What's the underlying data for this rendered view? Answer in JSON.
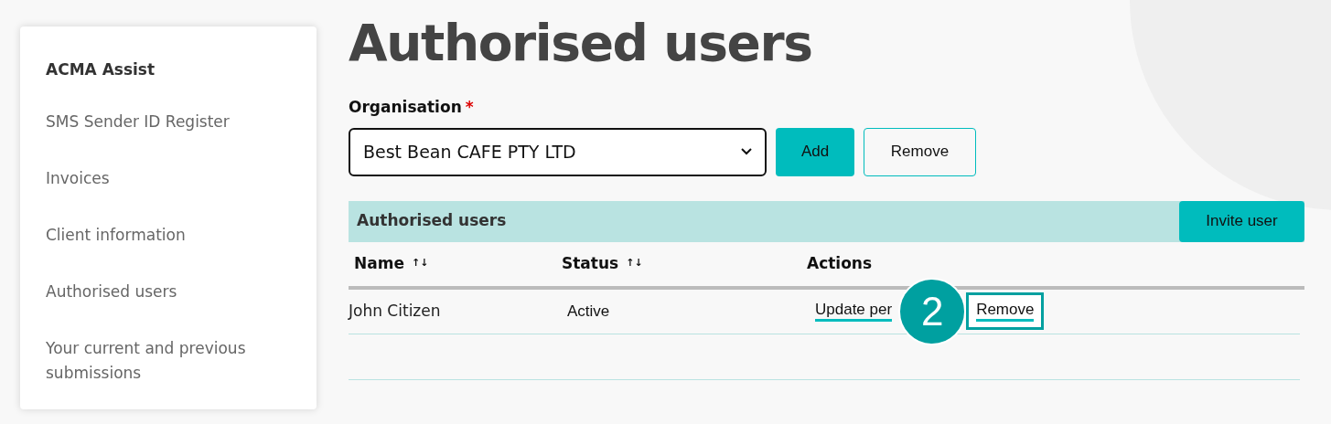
{
  "sidebar": {
    "title": "ACMA Assist",
    "items": [
      {
        "label": "SMS Sender ID Register"
      },
      {
        "label": "Invoices"
      },
      {
        "label": "Client information"
      },
      {
        "label": "Authorised users"
      },
      {
        "label": "Your current and previous submissions"
      }
    ]
  },
  "page_title": "Authorised users",
  "organisation": {
    "label": "Organisation",
    "required_mark": "*",
    "value": "Best Bean CAFE PTY LTD",
    "buttons": [
      "Add",
      "Remove"
    ]
  },
  "table": {
    "title": "Authorised users",
    "invite_button": "Invite user",
    "columns": [
      {
        "label": "Name",
        "sort_icon": "↑↓"
      },
      {
        "label": "Status",
        "sort_icon": "↑↓"
      },
      {
        "label": "Actions"
      }
    ],
    "rows": [
      {
        "name": "John Citizen",
        "status": "Active",
        "actions": [
          {
            "label": "Update per",
            "highlighted": false
          },
          {
            "label": "Remove",
            "highlighted": true
          }
        ]
      }
    ]
  },
  "step_badge": "2"
}
